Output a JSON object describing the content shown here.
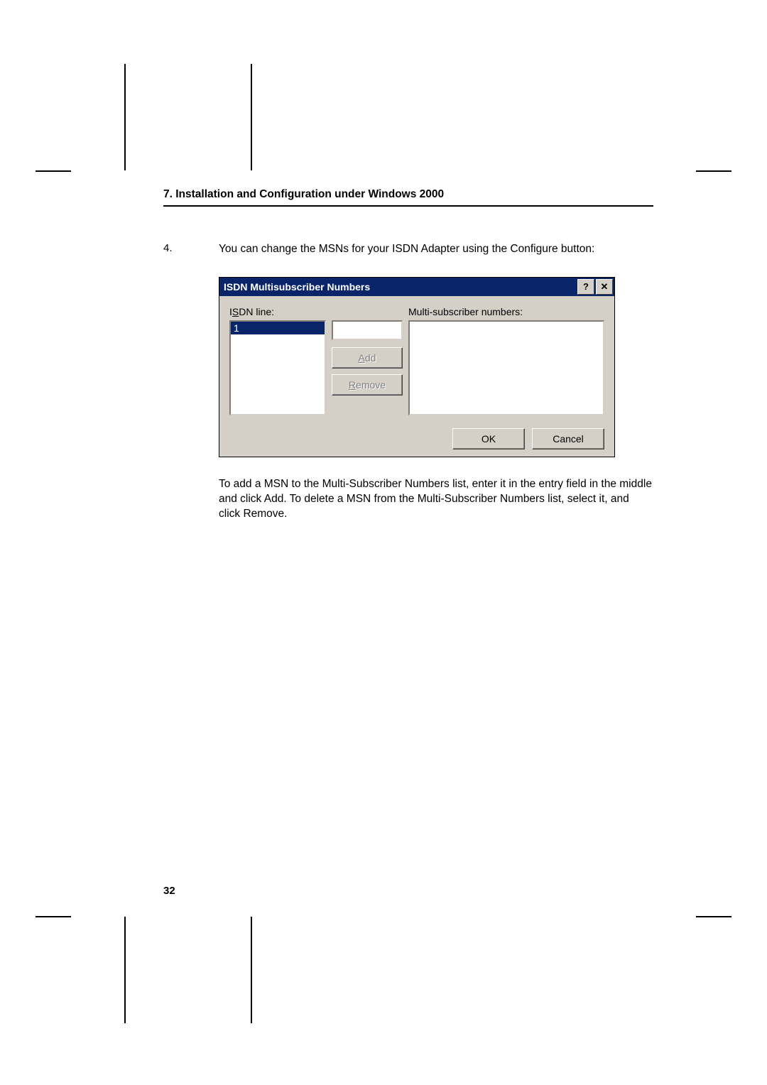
{
  "header": {
    "title": "7. Installation and Configuration under Windows 2000"
  },
  "step": {
    "num": "4.",
    "intro": "You can change the MSNs for your ISDN Adapter using the Configure button:",
    "outro": "To add a MSN to the Multi-Subscriber Numbers list, enter it in the entry field in the middle and click Add. To delete a MSN from the Multi-Subscriber Numbers list, select it, and click Remove."
  },
  "dialog": {
    "title": "ISDN Multisubscriber Numbers",
    "help_glyph": "?",
    "close_glyph": "✕",
    "isdn_label_pre": "I",
    "isdn_label_ul": "S",
    "isdn_label_post": "DN line:",
    "msn_label_ul": "M",
    "msn_label_post": "ulti-subscriber numbers:",
    "line_items": [
      "1"
    ],
    "add_ul": "A",
    "add_post": "dd",
    "remove_ul": "R",
    "remove_post": "emove",
    "ok": "OK",
    "cancel": "Cancel"
  },
  "page_number": "32"
}
